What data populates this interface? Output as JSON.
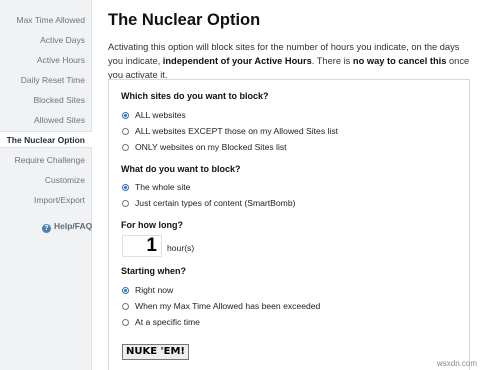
{
  "sidebar": {
    "items": [
      {
        "label": "Max Time Allowed"
      },
      {
        "label": "Active Days"
      },
      {
        "label": "Active Hours"
      },
      {
        "label": "Daily Reset Time"
      },
      {
        "label": "Blocked Sites"
      },
      {
        "label": "Allowed Sites"
      },
      {
        "label": "The Nuclear Option",
        "active": true
      },
      {
        "label": "Require Challenge"
      },
      {
        "label": "Customize"
      },
      {
        "label": "Import/Export"
      }
    ],
    "help_label": "Help/FAQ",
    "help_icon": "question-circle-icon"
  },
  "main": {
    "title": "The Nuclear Option",
    "intro": {
      "part1": "Activating this option will block sites for the number of hours you indicate, on the days you indicate, ",
      "bold1": "independent of your Active Hours",
      "part2": ". There is ",
      "bold2": "no way to cancel this",
      "part3": " once you activate it."
    }
  },
  "form": {
    "which_sites": {
      "question": "Which sites do you want to block?",
      "options": [
        "ALL websites",
        "ALL websites EXCEPT those on my Allowed Sites list",
        "ONLY websites on my Blocked Sites list"
      ],
      "selected": 0
    },
    "what_block": {
      "question": "What do you want to block?",
      "options": [
        "The whole site",
        "Just certain types of content (SmartBomb)"
      ],
      "selected": 0
    },
    "how_long": {
      "question": "For how long?",
      "value": "1",
      "unit": "hour(s)"
    },
    "starting_when": {
      "question": "Starting when?",
      "options": [
        "Right now",
        "When my Max Time Allowed has been exceeded",
        "At a specific time"
      ],
      "selected": 0
    },
    "submit_label": "NUKE 'EM!"
  },
  "watermark": "wsxdn.com",
  "colors": {
    "accent": "#2d6fc9",
    "sidebar_bg": "#f0f2f4",
    "help_icon": "#4a7fb8"
  }
}
